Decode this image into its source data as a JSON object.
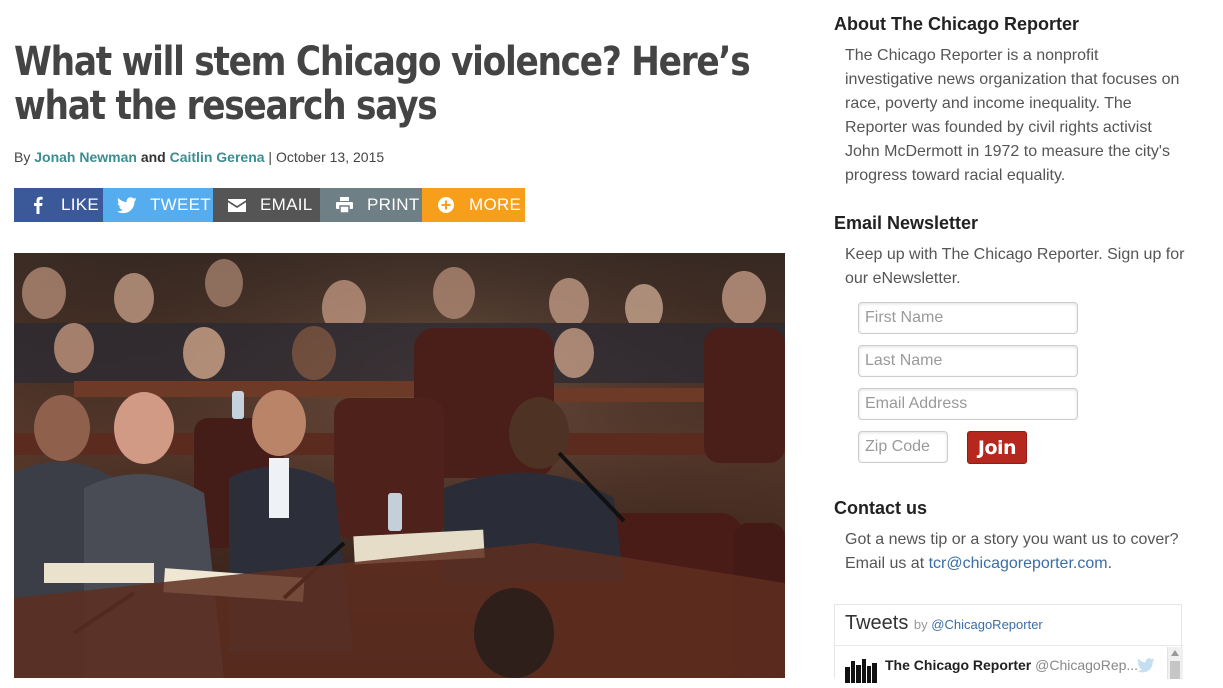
{
  "article": {
    "headline": "What will stem Chicago violence? Here’s what the research says",
    "byline": {
      "prefix": "By",
      "author1": "Jonah Newman",
      "and": "and",
      "author2": "Caitlin Gerena",
      "separator": "|",
      "date": "October 13, 2015"
    },
    "share": {
      "like": "LIKE",
      "tweet": "TWEET",
      "email": "EMAIL",
      "print": "PRINT",
      "more": "MORE"
    },
    "share_colors": {
      "like": "#3b5998",
      "tweet": "#55acee",
      "email": "#555555",
      "print": "#6f7f86",
      "more": "#f79f1a"
    }
  },
  "sidebar": {
    "about": {
      "title": "About The Chicago Reporter",
      "body": "The Chicago Reporter is a nonprofit investigative news organization that focuses on race, poverty and income inequality. The Reporter was founded by civil rights activist John McDermott in 1972 to measure the city's progress toward racial equality."
    },
    "newsletter": {
      "title": "Email Newsletter",
      "body": "Keep up with The Chicago Reporter. Sign up for our eNewsletter.",
      "first_name_placeholder": "First Name",
      "last_name_placeholder": "Last Name",
      "email_placeholder": "Email Address",
      "zip_placeholder": "Zip Code",
      "join_label": "Join"
    },
    "contact": {
      "title": "Contact us",
      "body_prefix": "Got a news tip or a story you want us to cover? Email us at",
      "email": "tcr@chicagoreporter.com",
      "body_suffix": "."
    },
    "tweets": {
      "title": "Tweets",
      "by": "by",
      "handle_link": "@ChicagoReporter",
      "item_name": "The Chicago Reporter",
      "item_handle": "@ChicagoRep..."
    }
  },
  "icons": {
    "like": "facebook-icon",
    "tweet": "twitter-icon",
    "email": "envelope-icon",
    "print": "printer-icon",
    "more": "plus-circle-icon"
  }
}
